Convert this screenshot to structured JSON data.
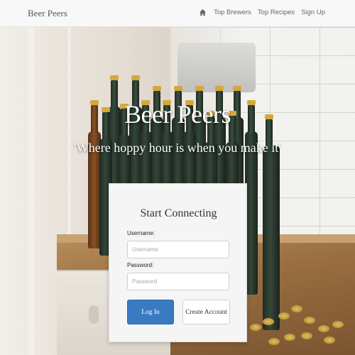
{
  "navbar": {
    "brand": "Beer Peers",
    "home_icon": "home-icon",
    "links": [
      "Top Brewers",
      "Top Recipes",
      "Sign Up"
    ]
  },
  "hero": {
    "title": "Beer Peers",
    "tagline": "'Where hoppy hour is when you make it'"
  },
  "login": {
    "heading": "Start Connecting",
    "username_label": "Username:",
    "username_placeholder": "Username",
    "username_value": "",
    "password_label": "Password:",
    "password_placeholder": "Password",
    "password_value": "",
    "login_button": "Log In",
    "create_button": "Create Account"
  },
  "colors": {
    "primary_button": "#3a7ac0",
    "navbar_bg": "#f8f8f8",
    "card_bg": "#f5f5f5"
  }
}
